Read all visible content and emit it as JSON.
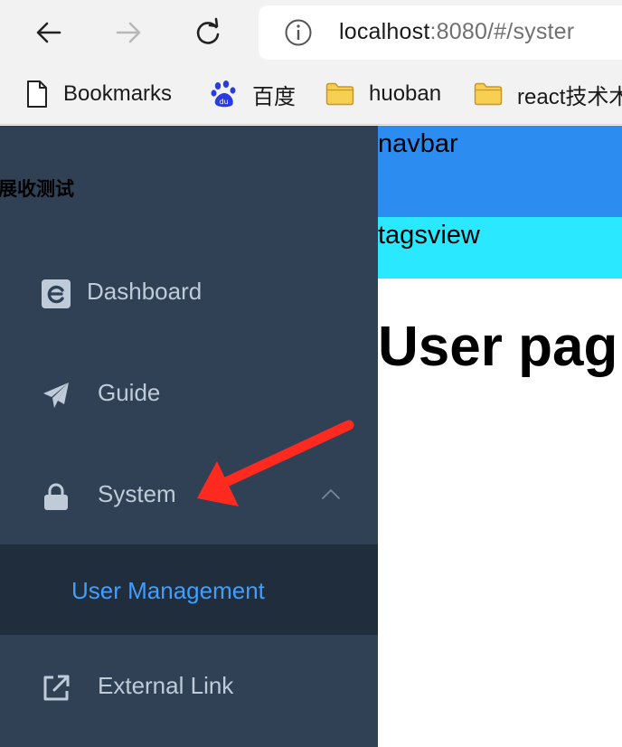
{
  "browser": {
    "url_host": "localhost",
    "url_rest": ":8080/#/syster",
    "icons": {
      "back": "back-arrow-icon",
      "forward": "forward-arrow-icon",
      "reload": "reload-icon",
      "info": "info-icon"
    }
  },
  "bookmarks": [
    {
      "label": "Bookmarks",
      "icon": "document-icon"
    },
    {
      "label": "百度",
      "icon": "baidu-paw-icon"
    },
    {
      "label": "huoban",
      "icon": "folder-icon"
    },
    {
      "label": "react技术木",
      "icon": "folder-icon"
    }
  ],
  "sidebar": {
    "title": "展收测试",
    "items": [
      {
        "label": "Dashboard",
        "icon": "dashboard-icon"
      },
      {
        "label": "Guide",
        "icon": "paper-plane-icon"
      },
      {
        "label": "System",
        "icon": "lock-icon",
        "expanded": true
      },
      {
        "label": "External Link",
        "icon": "external-link-icon"
      }
    ],
    "submenu": [
      {
        "label": "User Management",
        "active": true
      }
    ]
  },
  "main": {
    "navbar_text": "navbar",
    "tagsview_text": "tagsview",
    "heading": "User pag"
  },
  "colors": {
    "sidebar_bg": "#304156",
    "submenu_bg": "#1f2d3d",
    "active_text": "#409eff",
    "menu_text": "#bfcbd9",
    "navbar_bg": "#2d8cf0",
    "tagsview_bg": "#2ae8ff",
    "annotation_arrow": "#ff2a1f"
  }
}
